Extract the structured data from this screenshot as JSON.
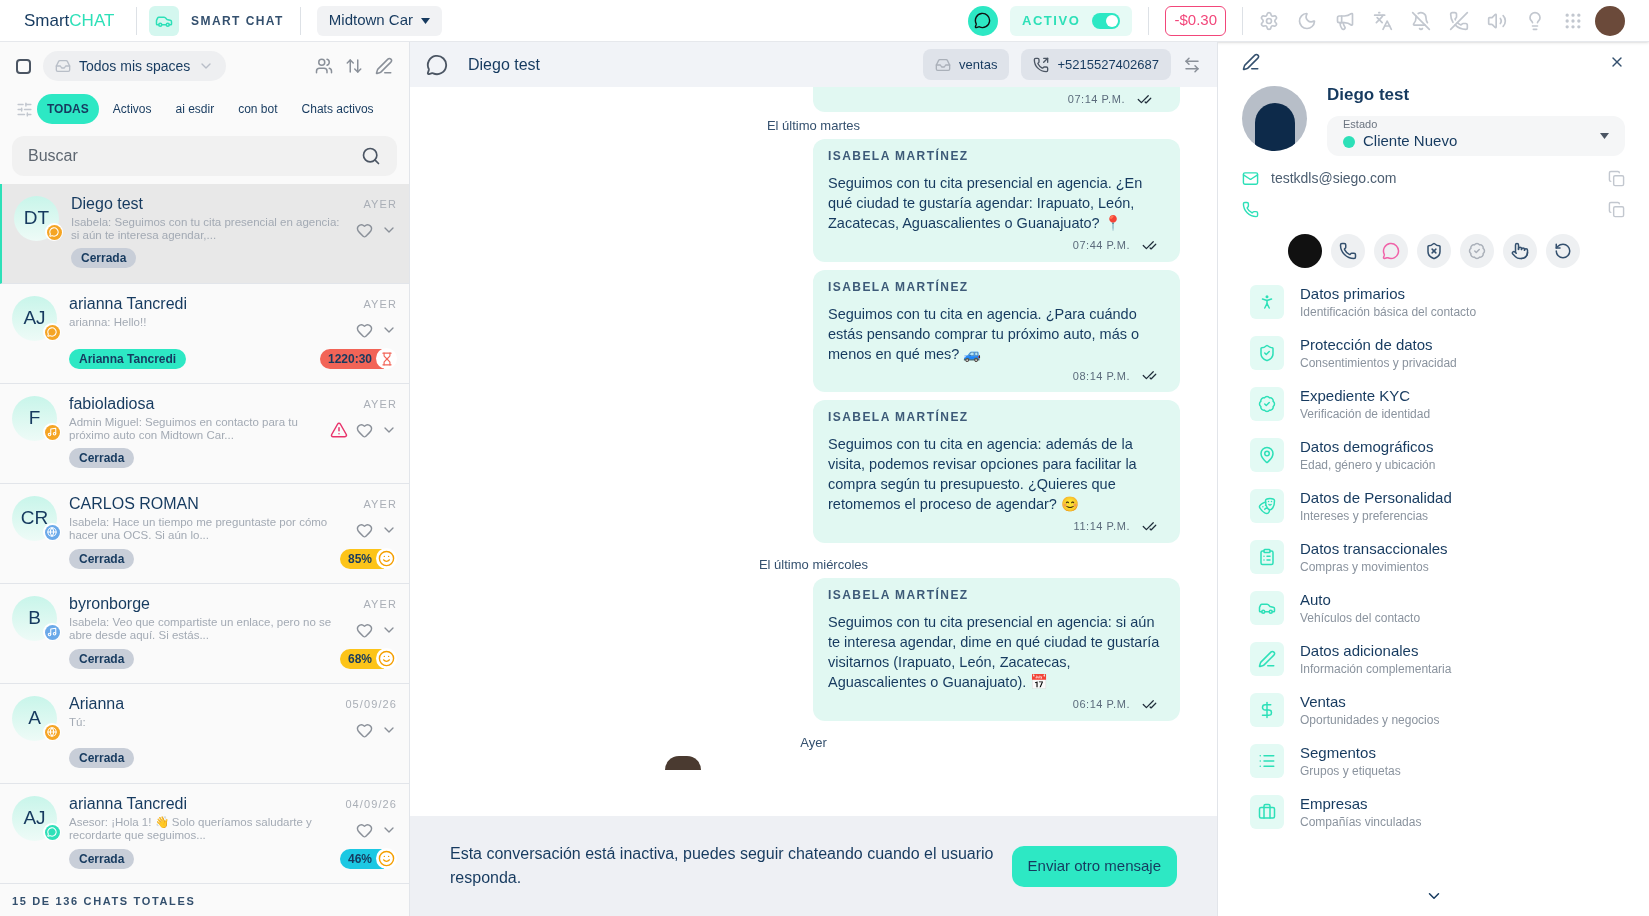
{
  "topbar": {
    "logo_main": "Smart",
    "logo_accent": "CHAT",
    "app_label": "SMART CHAT",
    "workspace": "Midtown Car",
    "status": {
      "label": "ACTIVO",
      "on": true
    },
    "balance": "-$0.30"
  },
  "inbox": {
    "select_all": {
      "checked": false
    },
    "spaces": "Todos mis spaces",
    "filters": [
      {
        "label": "TODAS",
        "selected": true
      },
      {
        "label": "Activos",
        "selected": false
      },
      {
        "label": "ai esdir",
        "selected": false
      },
      {
        "label": "con bot",
        "selected": false
      },
      {
        "label": "Chats activos",
        "selected": false
      }
    ],
    "search": {
      "placeholder": "Buscar"
    },
    "chats": [
      {
        "initials": "DT",
        "name": "Diego test",
        "badge": {
          "kind": "whatsapp",
          "color": "#f5a524"
        },
        "preview": "Isabela: Seguimos con tu cita presencial en agencia: si aún te interesa agendar,...",
        "time": "AYER",
        "selected": true,
        "warning": false,
        "tag": {
          "label": "Cerrada",
          "kind": "closed"
        }
      },
      {
        "initials": "AJ",
        "name": "arianna Tancredi",
        "badge": {
          "kind": "whatsapp",
          "color": "#f5a524"
        },
        "preview": "arianna: Hello!!",
        "time": "AYER",
        "selected": false,
        "warning": false,
        "tag": {
          "label": "Arianna Tancredi",
          "kind": "agent"
        },
        "score": {
          "label": "1220:30",
          "color": "#f26457"
        }
      },
      {
        "initials": "F",
        "name": "fabioladiosa",
        "badge": {
          "kind": "music",
          "color": "#f5a524"
        },
        "preview": "Admin Miguel: Seguimos en contacto para tu próximo auto con Midtown Car...",
        "time": "AYER",
        "selected": false,
        "warning": true,
        "tag": {
          "label": "Cerrada",
          "kind": "closed"
        }
      },
      {
        "initials": "CR",
        "name": "CARLOS ROMAN",
        "badge": {
          "kind": "globe",
          "color": "#6aa9e9"
        },
        "preview": "Isabela: Hace un tiempo me preguntaste por cómo hacer una OCS. Si aún lo...",
        "time": "AYER",
        "selected": false,
        "warning": false,
        "tag": {
          "label": "Cerrada",
          "kind": "closed"
        },
        "score": {
          "label": "85%",
          "color": "#fcc419"
        }
      },
      {
        "initials": "B",
        "name": "byronborge",
        "badge": {
          "kind": "music",
          "color": "#6aa9e9"
        },
        "preview": "Isabela: Veo que compartiste un enlace, pero no se abre desde aquí. Si estás...",
        "time": "AYER",
        "selected": false,
        "warning": false,
        "tag": {
          "label": "Cerrada",
          "kind": "closed"
        },
        "score": {
          "label": "68%",
          "color": "#fcc419"
        }
      },
      {
        "initials": "A",
        "name": "Arianna",
        "badge": {
          "kind": "globe",
          "color": "#f5a524"
        },
        "preview": "Tú:",
        "time": "05/09/26",
        "selected": false,
        "warning": false,
        "tag": {
          "label": "Cerrada",
          "kind": "closed"
        }
      },
      {
        "initials": "AJ",
        "name": "arianna Tancredi",
        "badge": {
          "kind": "whatsapp",
          "color": "#2de0b8"
        },
        "preview": "Asesor: ¡Hola 1! 👋 Solo queríamos saludarte y recordarte que seguimos...",
        "time": "04/09/26",
        "selected": false,
        "warning": false,
        "tag": {
          "label": "Cerrada",
          "kind": "closed"
        },
        "score": {
          "label": "46%",
          "color": "#1cc8e3"
        }
      }
    ],
    "footer": "15 DE 136 CHATS TOTALES"
  },
  "conversation": {
    "title": "Diego test",
    "space": "ventas",
    "phone": "+5215527402687",
    "messages": [
      {
        "kind": "partial",
        "time": "07:14 P.M."
      },
      {
        "kind": "separator",
        "text": "El último martes"
      },
      {
        "kind": "message",
        "author": "ISABELA MARTÍNEZ",
        "text": "Seguimos con tu cita presencial en agencia. ¿En qué ciudad te gustaría agendar: Irapuato, León, Zacatecas, Aguascalientes o Guanajuato? 📍",
        "time": "07:44 P.M."
      },
      {
        "kind": "message",
        "author": "ISABELA MARTÍNEZ",
        "text": "Seguimos con tu cita en agencia. ¿Para cuándo estás pensando comprar tu próximo auto, más o menos en qué mes? 🚙",
        "time": "08:14 P.M."
      },
      {
        "kind": "message",
        "author": "ISABELA MARTÍNEZ",
        "text": "Seguimos con tu cita en agencia: además de la visita, podemos revisar opciones para facilitar la compra según tu presupuesto. ¿Quieres que retomemos el proceso de agendar? 😊",
        "time": "11:14 P.M."
      },
      {
        "kind": "separator",
        "text": "El último miércoles"
      },
      {
        "kind": "message",
        "author": "ISABELA MARTÍNEZ",
        "text": "Seguimos con tu cita presencial en agencia: si aún te interesa agendar, dime en qué ciudad te gustaría visitarnos (Irapuato, León, Zacatecas, Aguascalientes o Guanajuato). 📅",
        "time": "06:14 P.M."
      },
      {
        "kind": "separator",
        "text": "Ayer"
      }
    ],
    "notice": "Esta conversación está inactiva, puedes seguir chateando cuando el usuario responda.",
    "action": "Enviar otro mensaje"
  },
  "contact": {
    "name": "Diego test",
    "status_label": "Estado",
    "status": "Cliente Nuevo",
    "status_dot": {
      "color": "#2de0b8"
    },
    "email": "testkdls@siego.com",
    "sections": [
      {
        "title": "Datos primarios",
        "subtitle": "Identificación básica del contacto"
      },
      {
        "title": "Protección de datos",
        "subtitle": "Consentimientos y privacidad"
      },
      {
        "title": "Expediente KYC",
        "subtitle": "Verificación de identidad"
      },
      {
        "title": "Datos demográficos",
        "subtitle": "Edad, género y ubicación"
      },
      {
        "title": "Datos de Personalidad",
        "subtitle": "Intereses y preferencias"
      },
      {
        "title": "Datos transaccionales",
        "subtitle": "Compras y movimientos"
      },
      {
        "title": "Auto",
        "subtitle": "Vehículos del contacto"
      },
      {
        "title": "Datos adicionales",
        "subtitle": "Información complementaria"
      },
      {
        "title": "Ventas",
        "subtitle": "Oportunidades y negocios"
      },
      {
        "title": "Segmentos",
        "subtitle": "Grupos y etiquetas"
      },
      {
        "title": "Empresas",
        "subtitle": "Compañías vinculadas"
      }
    ]
  }
}
